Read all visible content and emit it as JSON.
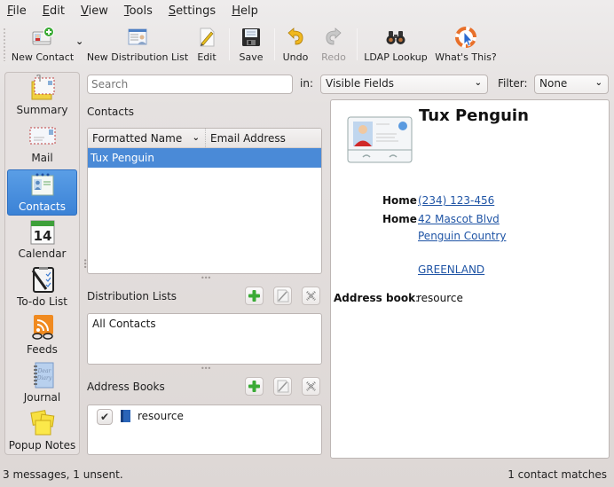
{
  "menubar": {
    "items": [
      {
        "label": "File",
        "accel": "F",
        "rest": "ile"
      },
      {
        "label": "Edit",
        "accel": "E",
        "rest": "dit"
      },
      {
        "label": "View",
        "accel": "V",
        "rest": "iew"
      },
      {
        "label": "Tools",
        "accel": "T",
        "rest": "ools"
      },
      {
        "label": "Settings",
        "accel": "S",
        "rest": "ettings"
      },
      {
        "label": "Help",
        "accel": "H",
        "rest": "elp"
      }
    ]
  },
  "toolbar": {
    "new_contact": "New Contact",
    "new_distribution_list": "New Distribution List",
    "edit": "Edit",
    "save": "Save",
    "undo": "Undo",
    "redo": "Redo",
    "ldap_lookup": "LDAP Lookup",
    "whats_this": "What's This?"
  },
  "sidebar": {
    "items": [
      {
        "label": "Summary",
        "icon": "summary-icon"
      },
      {
        "label": "Mail",
        "icon": "mail-icon"
      },
      {
        "label": "Contacts",
        "icon": "contacts-icon",
        "active": true
      },
      {
        "label": "Calendar",
        "icon": "calendar-icon",
        "day": "14"
      },
      {
        "label": "To-do List",
        "icon": "todo-icon"
      },
      {
        "label": "Feeds",
        "icon": "feeds-icon"
      },
      {
        "label": "Journal",
        "icon": "journal-icon"
      },
      {
        "label": "Popup Notes",
        "icon": "popup-notes-icon"
      }
    ]
  },
  "search": {
    "placeholder": "Search",
    "value": "",
    "in_label": "in:",
    "in_value": "Visible Fields",
    "filter_label": "Filter:",
    "filter_value": "None"
  },
  "contacts": {
    "section_label": "Contacts",
    "columns": [
      "Formatted Name",
      "Email Address"
    ],
    "rows": [
      {
        "name": "Tux Penguin",
        "email": "",
        "selected": true
      }
    ]
  },
  "distribution_lists": {
    "section_label": "Distribution Lists",
    "items": [
      "All Contacts"
    ]
  },
  "address_books": {
    "section_label": "Address Books",
    "items": [
      {
        "label": "resource",
        "checked": true
      }
    ]
  },
  "detail": {
    "name": "Tux Penguin",
    "phone_label": "Home",
    "phone": "(234) 123-456",
    "address_label": "Home",
    "address_lines": [
      "42 Mascot Blvd",
      "Penguin Country",
      "",
      "GREENLAND"
    ],
    "address_book_label": "Address book",
    "address_book_value": "resource"
  },
  "statusbar": {
    "left": "3 messages, 1 unsent.",
    "right": "1 contact matches"
  },
  "colors": {
    "selection": "#4a8ad7",
    "link": "#1f54a5",
    "active_sidebar": "#3b82d6"
  }
}
